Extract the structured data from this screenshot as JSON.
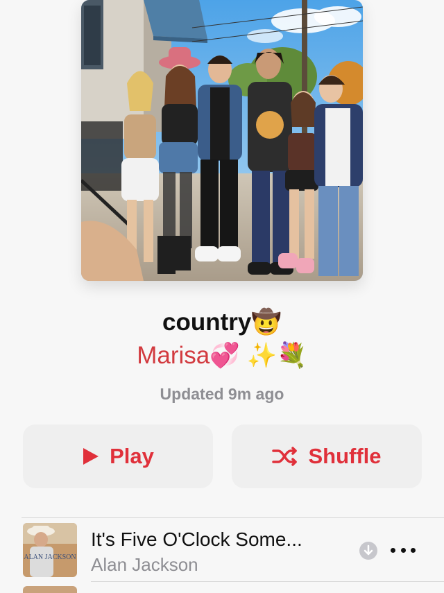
{
  "playlist": {
    "title": "country",
    "title_emoji": "🤠",
    "curator": "Marisa",
    "curator_emojis": [
      "💞",
      "✨",
      "💐"
    ],
    "updated": "Updated 9m ago"
  },
  "actions": {
    "play_label": "Play",
    "shuffle_label": "Shuffle"
  },
  "tracks": [
    {
      "title": "It's Five O'Clock Some...",
      "artist": "Alan Jackson",
      "album_art_text": "ALAN JACKSON"
    }
  ],
  "colors": {
    "accent": "#e0303a",
    "curator": "#d23a3f",
    "secondary_text": "#8e8e93",
    "button_bg": "#efefef",
    "background": "#f7f7f7"
  },
  "icons": {
    "play": "play-icon",
    "shuffle": "shuffle-icon",
    "download": "download-icon",
    "more": "more-icon"
  }
}
